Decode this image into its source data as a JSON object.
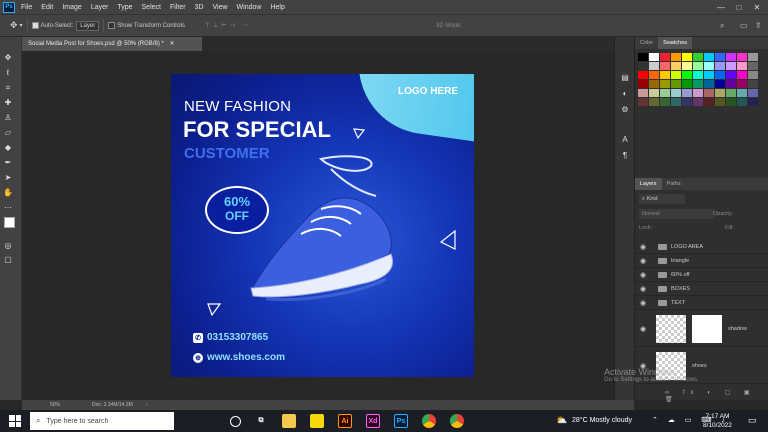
{
  "app": {
    "name": "Ps",
    "menu": [
      "File",
      "Edit",
      "Image",
      "Layer",
      "Type",
      "Select",
      "Filter",
      "3D",
      "View",
      "Window",
      "Help"
    ]
  },
  "options": {
    "auto_select_label": "Auto-Select:",
    "auto_select_value": "Layer",
    "transform_label": "Show Transform Controls",
    "mode_3d": "3D Mode:"
  },
  "document": {
    "tab_title": "Social Media Post for Shoes.psd @ 50% (RGB/8) *",
    "zoom": "50%",
    "doc_info": "Doc: 3.34M/14.3M"
  },
  "poster": {
    "logo": "LOGO HERE",
    "line1": "NEW FASHION",
    "line2": "FOR SPECIAL",
    "line3": "CUSTOMER",
    "badge_percent": "60%",
    "badge_off": "OFF",
    "phone": "03153307865",
    "website": "www.shoes.com"
  },
  "panels": {
    "color_tab": "Color",
    "swatches_tab": "Swatches",
    "layers_tab": "Layers",
    "paths_tab": "Paths",
    "kind_label": "Kind",
    "blend_mode": "Normal",
    "opacity_label": "Opacity:",
    "lock_label": "Lock:",
    "fill_label": "Fill:",
    "layers": [
      "LOGO AREA",
      "triangle",
      "60% off",
      "BOXES",
      "TEXT"
    ],
    "thumb_layers": [
      "shadow",
      "shoes"
    ]
  },
  "taskbar": {
    "search_placeholder": "Type here to search",
    "weather": "28°C  Mostly cloudy",
    "time": "7:17 AM",
    "date": "8/10/2022"
  },
  "watermark": {
    "line1": "Activate Windows",
    "line2": "Go to Settings to activate Windows."
  },
  "colors": {
    "poster_bg": "#1436b8",
    "accent": "#4cc6ee"
  }
}
